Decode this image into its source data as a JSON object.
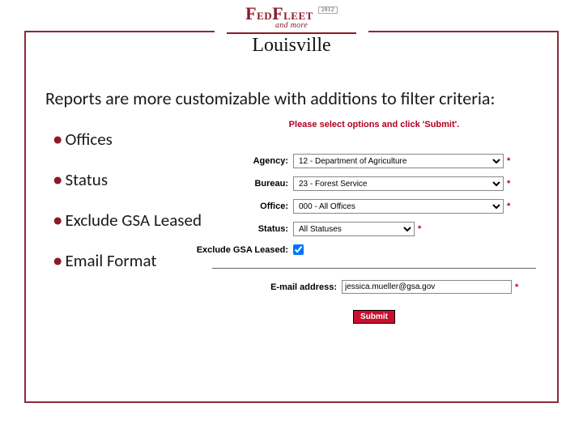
{
  "logo": {
    "brand_prefix": "F",
    "brand_mid": "ED",
    "brand_suffix": "F",
    "brand_end": "LEET",
    "year": "2012",
    "tagline": "and more",
    "city": "Louisville"
  },
  "heading": "Reports are more customizable with additions to filter criteria:",
  "bullets": {
    "b1": "Offices",
    "b2": "Status",
    "b3": "Exclude GSA Leased",
    "b4": "Email Format"
  },
  "form": {
    "instruction": "Please select options and click 'Submit'.",
    "agency_label": "Agency:",
    "agency_value": "12 - Department of Agriculture",
    "bureau_label": "Bureau:",
    "bureau_value": "23 - Forest Service",
    "office_label": "Office:",
    "office_value": "000 - All Offices",
    "status_label": "Status:",
    "status_value": "All Statuses",
    "exclude_label": "Exclude GSA Leased:",
    "email_label": "E-mail address:",
    "email_value": "jessica.mueller@gsa.gov",
    "submit_label": "Submit",
    "required_mark": "*"
  }
}
